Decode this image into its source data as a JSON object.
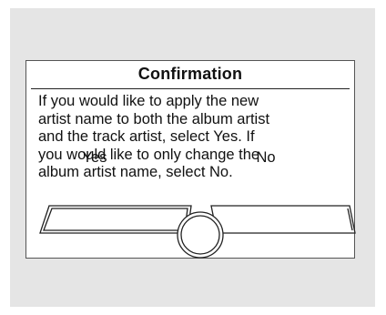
{
  "screen": {
    "background": "#e5e5e5"
  },
  "dialog": {
    "title": "Confirmation",
    "message_lines": [
      "If you would like to apply the new",
      "artist name to both the album artist",
      "and the track artist, select Yes. If",
      "you would like to only change the",
      "album artist name, select No."
    ],
    "buttons": {
      "yes_label": "Yes",
      "no_label": "No",
      "selected": "Yes"
    }
  },
  "controls": {
    "dial_icon": "rotary-dial-icon"
  }
}
